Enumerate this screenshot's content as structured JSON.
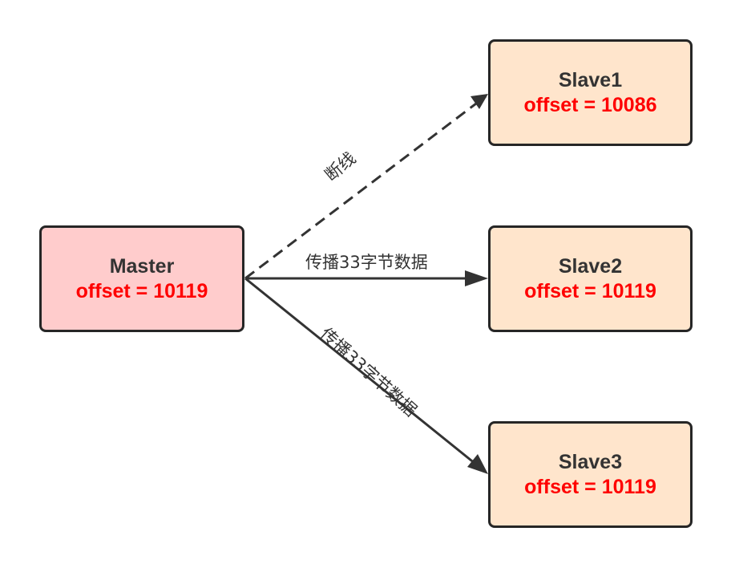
{
  "colors": {
    "master_fill": "#ffcccc",
    "slave_fill": "#ffe5cc",
    "border": "#262626",
    "offset_text": "#ff0000",
    "name_text": "#333333",
    "edge": "#333333"
  },
  "master": {
    "name": "Master",
    "offset": "offset = 10119"
  },
  "slaves": [
    {
      "name": "Slave1",
      "offset": "offset = 10086"
    },
    {
      "name": "Slave2",
      "offset": "offset = 10119"
    },
    {
      "name": "Slave3",
      "offset": "offset = 10119"
    }
  ],
  "edges": [
    {
      "from": "Master",
      "to": "Slave1",
      "label": "断线",
      "style": "dashed"
    },
    {
      "from": "Master",
      "to": "Slave2",
      "label": "传播33字节数据",
      "style": "solid"
    },
    {
      "from": "Master",
      "to": "Slave3",
      "label": "传播33字节数据",
      "style": "solid"
    }
  ]
}
